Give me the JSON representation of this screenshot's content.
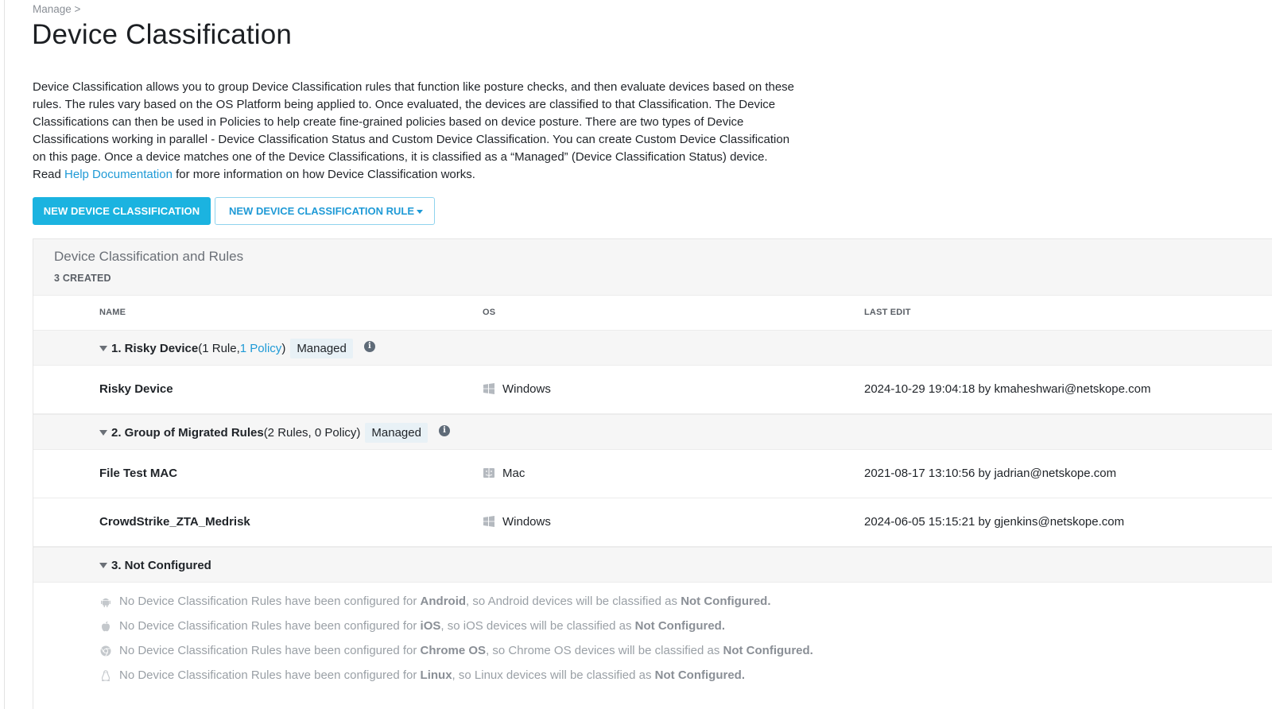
{
  "breadcrumb": "Manage >",
  "page_title": "Device Classification",
  "intro": {
    "text_before_link": "Device Classification allows you to group Device Classification rules that function like posture checks, and then evaluate devices based on these rules. The rules vary based on the OS Platform being applied to. Once evaluated, the devices are classified to that Classification. The Device Classifications can then be used in Policies to help create fine-grained policies based on device posture. There are two types of Device Classifications working in parallel - Device Classification Status and Custom Device Classification. You can create Custom Device Classification on this page. Once a device matches one of the Device Classifications, it is classified as a “Managed” (Device Classification Status) device. Read ",
    "link_text": "Help Documentation",
    "text_after_link": " for more information on how Device Classification works."
  },
  "buttons": {
    "new_classification": "NEW DEVICE CLASSIFICATION",
    "new_rule": "NEW DEVICE CLASSIFICATION RULE"
  },
  "panel": {
    "title": "Device Classification and Rules",
    "count": "3 CREATED",
    "columns": {
      "name": "NAME",
      "os": "OS",
      "last_edit": "LAST EDIT"
    }
  },
  "groups": [
    {
      "name": "1. Risky Device",
      "meta_before": " (1 Rule, ",
      "meta_link": "1 Policy",
      "meta_after": " )",
      "badge": "Managed",
      "rules": [
        {
          "name": "Risky Device",
          "os": "Windows",
          "os_icon": "windows-icon",
          "last_edit": "2024-10-29 19:04:18 by kmaheshwari@netskope.com"
        }
      ]
    },
    {
      "name": "2. Group of Migrated Rules",
      "meta": " (2 Rules, 0 Policy)",
      "badge": "Managed",
      "rules": [
        {
          "name": "File Test MAC",
          "os": "Mac",
          "os_icon": "mac-icon",
          "last_edit": "2021-08-17 13:10:56 by jadrian@netskope.com"
        },
        {
          "name": "CrowdStrike_ZTA_Medrisk",
          "os": "Windows",
          "os_icon": "windows-icon",
          "last_edit": "2024-06-05 15:15:21 by gjenkins@netskope.com"
        }
      ]
    },
    {
      "name": "3. Not Configured",
      "not_configured": [
        {
          "icon": "android-icon",
          "prefix": "No Device Classification Rules have been configured for ",
          "os": "Android",
          "middle": ", so Android devices will be classified as ",
          "status": "Not Configured."
        },
        {
          "icon": "apple-icon",
          "prefix": "No Device Classification Rules have been configured for ",
          "os": "iOS",
          "middle": ", so iOS devices will be classified as ",
          "status": "Not Configured."
        },
        {
          "icon": "chrome-icon",
          "prefix": "No Device Classification Rules have been configured for ",
          "os": "Chrome OS",
          "middle": ", so Chrome OS devices will be classified as ",
          "status": "Not Configured."
        },
        {
          "icon": "linux-icon",
          "prefix": "No Device Classification Rules have been configured for ",
          "os": "Linux",
          "middle": ", so Linux devices will be classified as ",
          "status": "Not Configured."
        }
      ]
    }
  ],
  "colors": {
    "accent": "#1bb3e0",
    "link": "#1f9ad6",
    "badge_bg": "#e8f1f6",
    "group_bg": "#f6f6f6"
  }
}
